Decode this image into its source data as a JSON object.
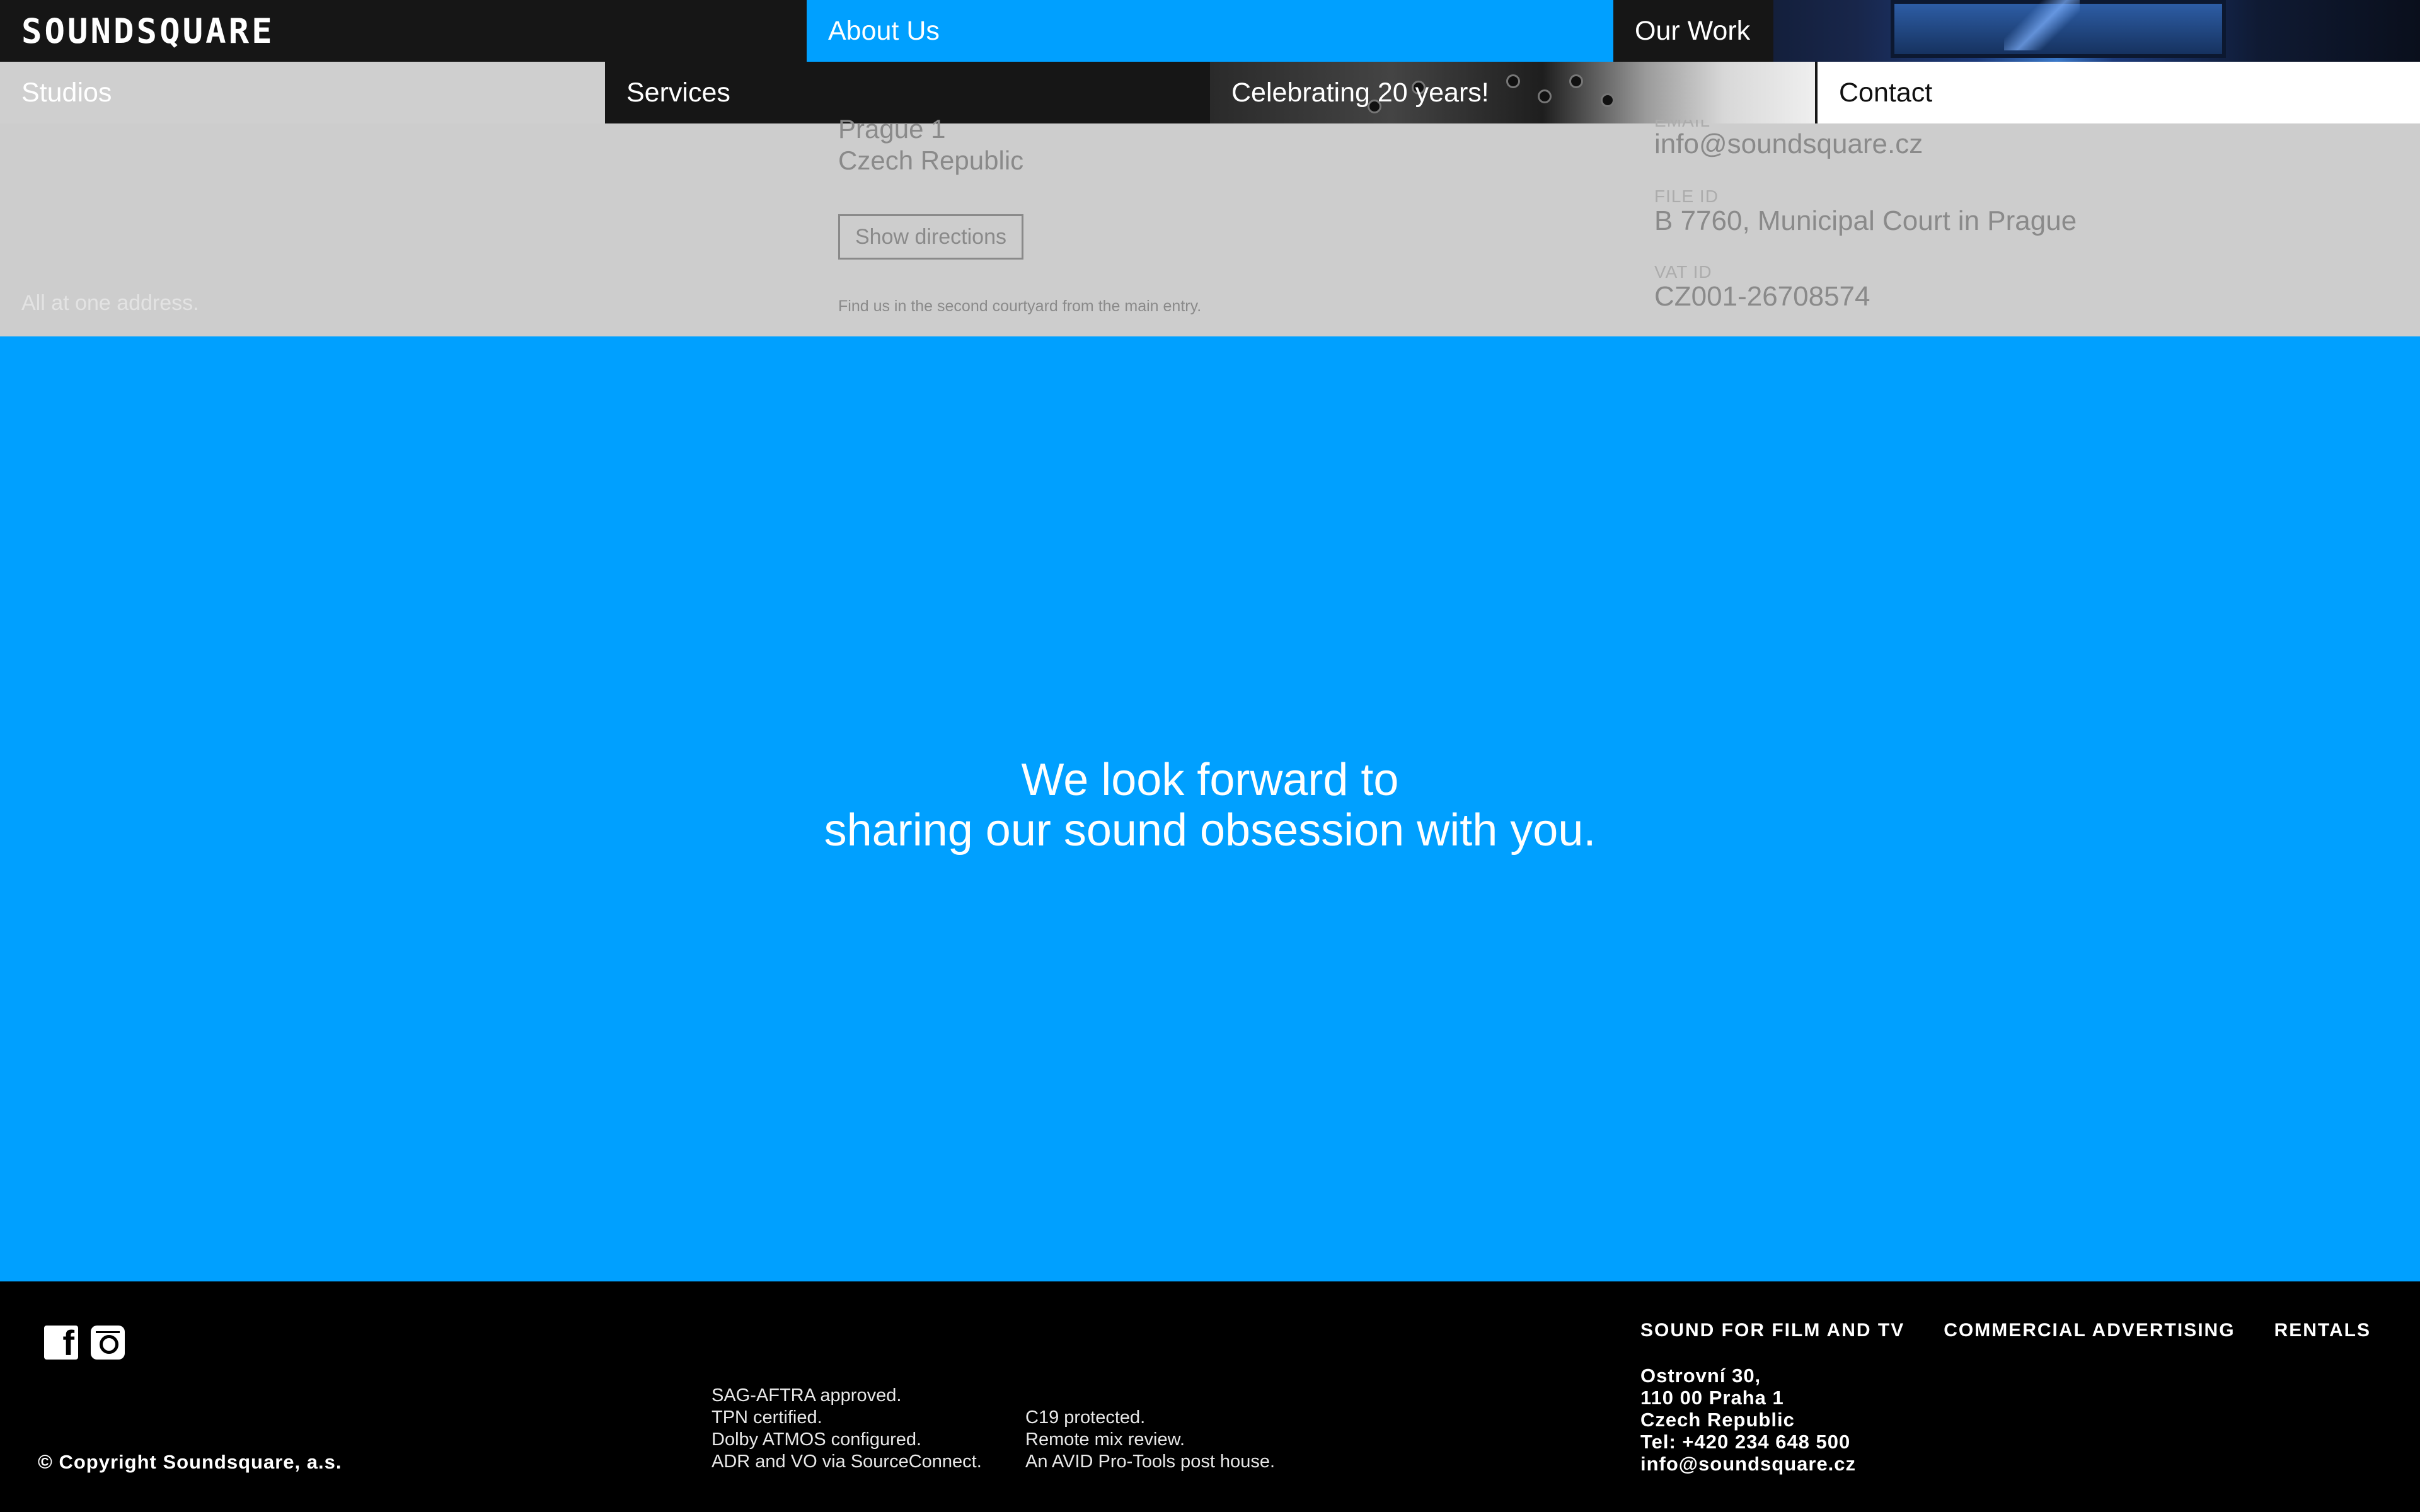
{
  "brand": {
    "logo_text": "SOUNDSQUARE"
  },
  "nav": {
    "about": "About Us",
    "our_work": "Our Work",
    "studios": "Studios",
    "services": "Services",
    "celebrating": "Celebrating 20 years!",
    "contact": "Contact"
  },
  "contact_section": {
    "left_note": "All at one address.",
    "address_lines": [
      "Prague 1",
      "Czech Republic"
    ],
    "directions_button": "Show directions",
    "find_note": "Find us in the second courtyard from the main entry.",
    "email_label": "EMAIL",
    "email": "info@soundsquare.cz",
    "file_id_label": "FILE ID",
    "file_id": "B 7760, Municipal Court in Prague",
    "vat_label": "VAT ID",
    "vat": "CZ001-26708574"
  },
  "hero": {
    "line1": "We look forward to",
    "line2": "sharing our sound obsession with you."
  },
  "footer": {
    "social": [
      "facebook-icon",
      "instagram-icon"
    ],
    "copyright": "© Copyright Soundsquare, a.s.",
    "cert_left": [
      "SAG-AFTRA approved.",
      "TPN certified.",
      "Dolby ATMOS configured.",
      "ADR and VO via SourceConnect."
    ],
    "cert_right": [
      "C19 protected.",
      "Remote mix review.",
      "An AVID Pro-Tools post house."
    ],
    "nav": [
      "SOUND FOR FILM AND TV",
      "COMMERCIAL ADVERTISING",
      "RENTALS"
    ],
    "address_lines": [
      "Ostrovní 30,",
      "110 00 Praha 1",
      "Czech Republic",
      "Tel: +420 234 648 500",
      "info@soundsquare.cz"
    ]
  },
  "colors": {
    "accent_blue": "#00a0ff",
    "nav_dark": "#161616",
    "gray_strip": "#cdcdcd"
  }
}
